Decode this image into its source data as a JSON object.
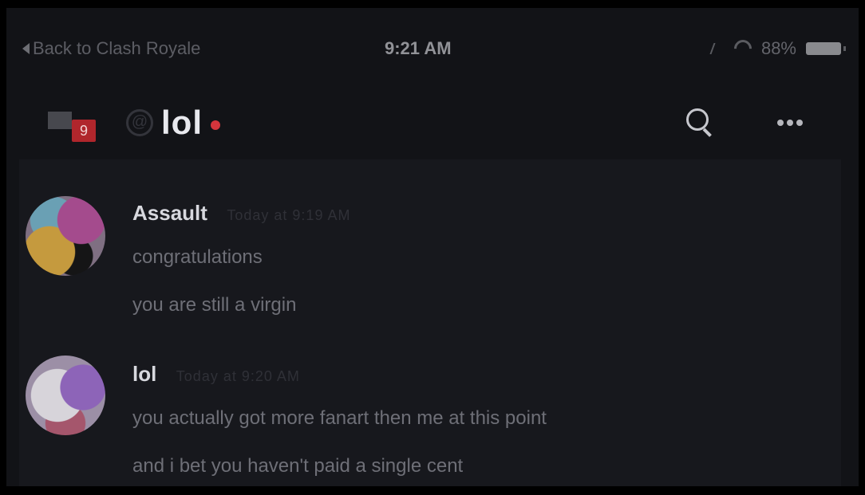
{
  "status_bar": {
    "back_label": "Back to Clash Royale",
    "time": "9:21 AM",
    "battery": "88%"
  },
  "header": {
    "menu_badge": "9",
    "at_symbol": "@",
    "channel_name": "lol",
    "icons": [
      "menu-icon",
      "at-icon",
      "search-icon",
      "more-icon"
    ]
  },
  "messages": [
    {
      "author": "Assault",
      "timestamp": "Today at 9:19 AM",
      "lines": [
        "congratulations",
        "you are still a virgin"
      ]
    },
    {
      "author": "lol",
      "timestamp": "Today at 9:20 AM",
      "lines": [
        "you actually got more fanart then me at this point",
        "and i bet you haven't paid a single cent"
      ]
    }
  ],
  "colors": {
    "background": "#121317",
    "status_dot": "#d4353c",
    "badge": "#b0262c"
  }
}
